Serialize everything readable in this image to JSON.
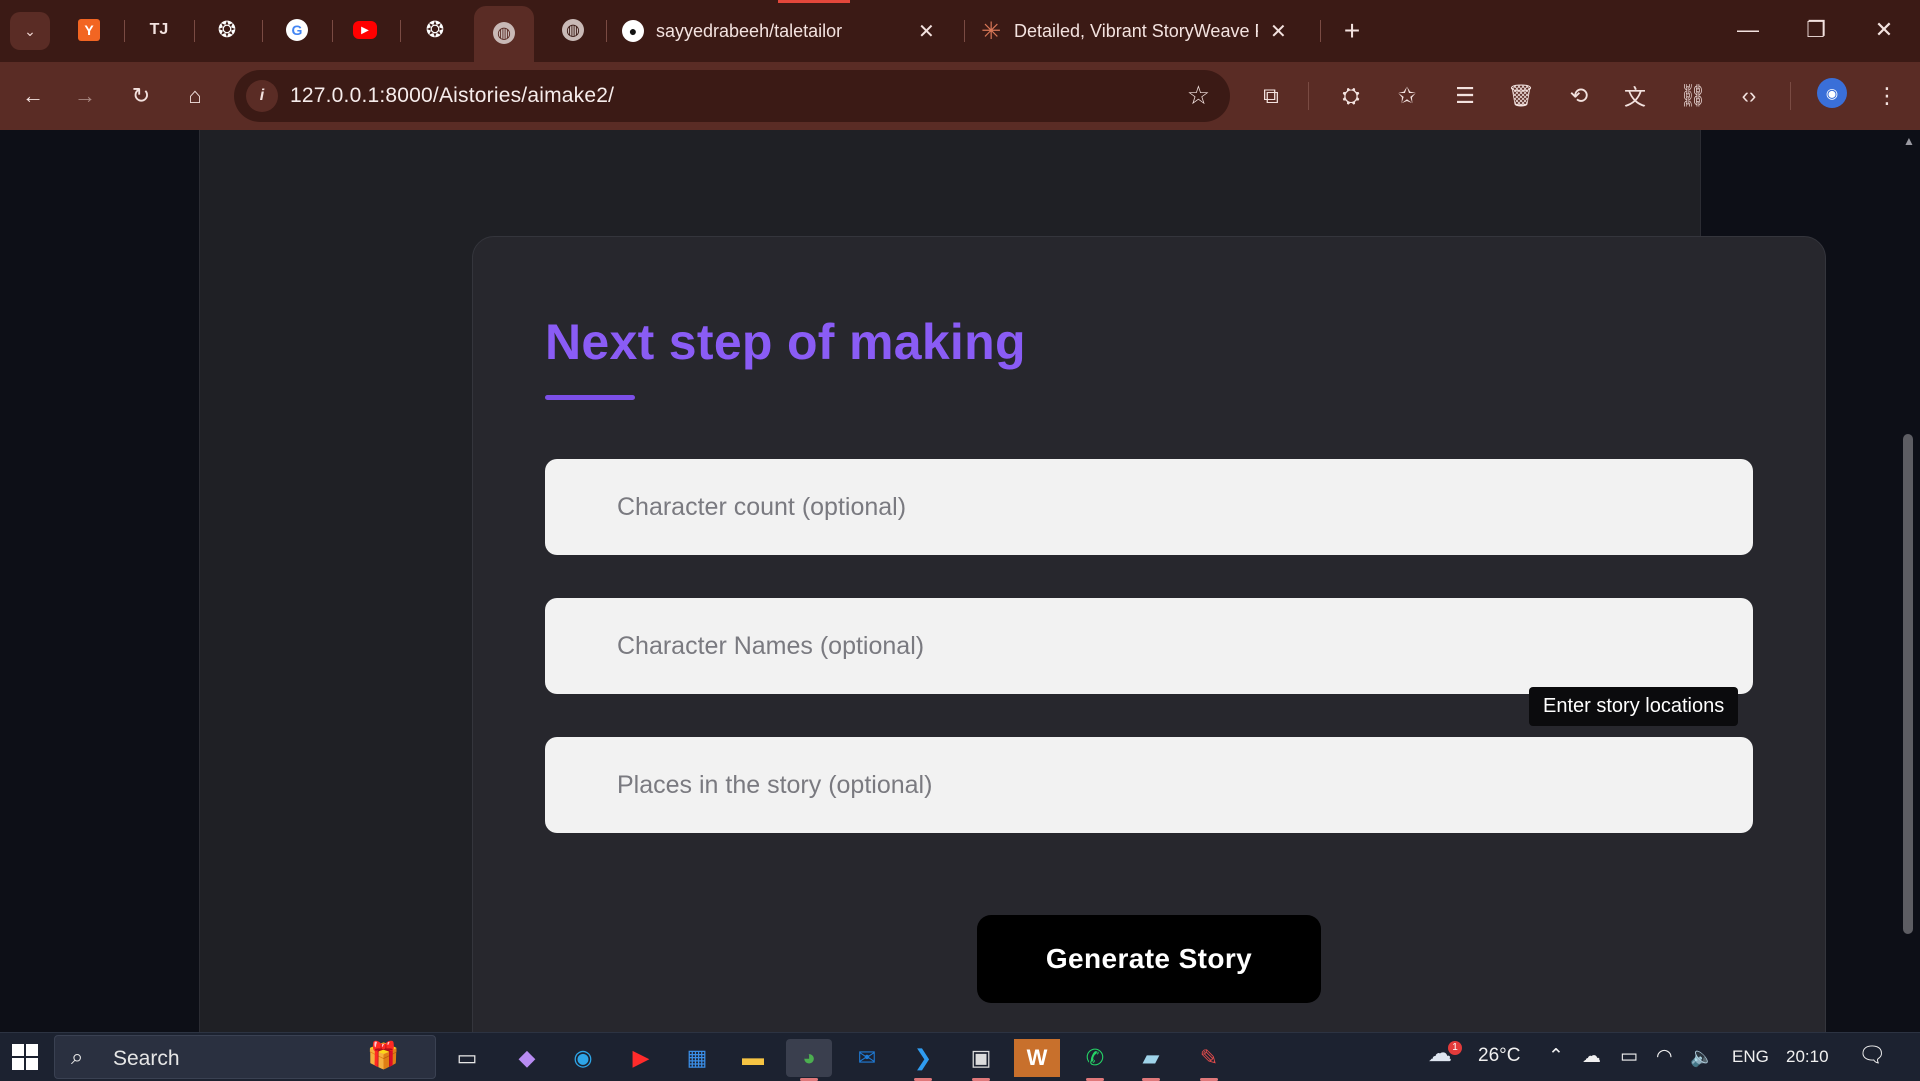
{
  "browser": {
    "pinned_tabs": [
      {
        "icon": "y-combinator-icon",
        "glyph": "Y",
        "color": "#f26522"
      },
      {
        "icon": "tj-icon",
        "glyph": "TJ",
        "color": "#3b1a15"
      },
      {
        "icon": "openai-icon",
        "glyph": "❂",
        "color": "#3b1a15"
      },
      {
        "icon": "google-icon",
        "glyph": "G",
        "color": "#ffffff"
      },
      {
        "icon": "youtube-icon",
        "glyph": "▶",
        "color": "#ff0000"
      },
      {
        "icon": "openai-icon",
        "glyph": "❂",
        "color": "#3b1a15"
      },
      {
        "icon": "globe-icon",
        "glyph": "◍",
        "color": "#5a2c25"
      },
      {
        "icon": "globe-icon",
        "glyph": "◍",
        "color": "#3b1a15"
      }
    ],
    "tabs": [
      {
        "title": "sayyedrabeeh/taletailor",
        "icon": "github-icon"
      },
      {
        "title": "Detailed, Vibrant StoryWeave R",
        "icon": "claude-icon"
      }
    ],
    "url": "127.0.0.1:8000/Aistories/aimake2/"
  },
  "page": {
    "heading": "Next step of making",
    "fields": [
      {
        "placeholder": "Character count (optional)"
      },
      {
        "placeholder": "Character Names (optional)"
      },
      {
        "placeholder": "Places in the story (optional)"
      }
    ],
    "tooltip": "Enter story locations",
    "generate_button": "Generate Story",
    "accent_color": "#8a5cf5"
  },
  "taskbar": {
    "search_label": "Search",
    "weather": "26°C",
    "weather_badge": "1",
    "language": "ENG",
    "time": "20:10"
  }
}
